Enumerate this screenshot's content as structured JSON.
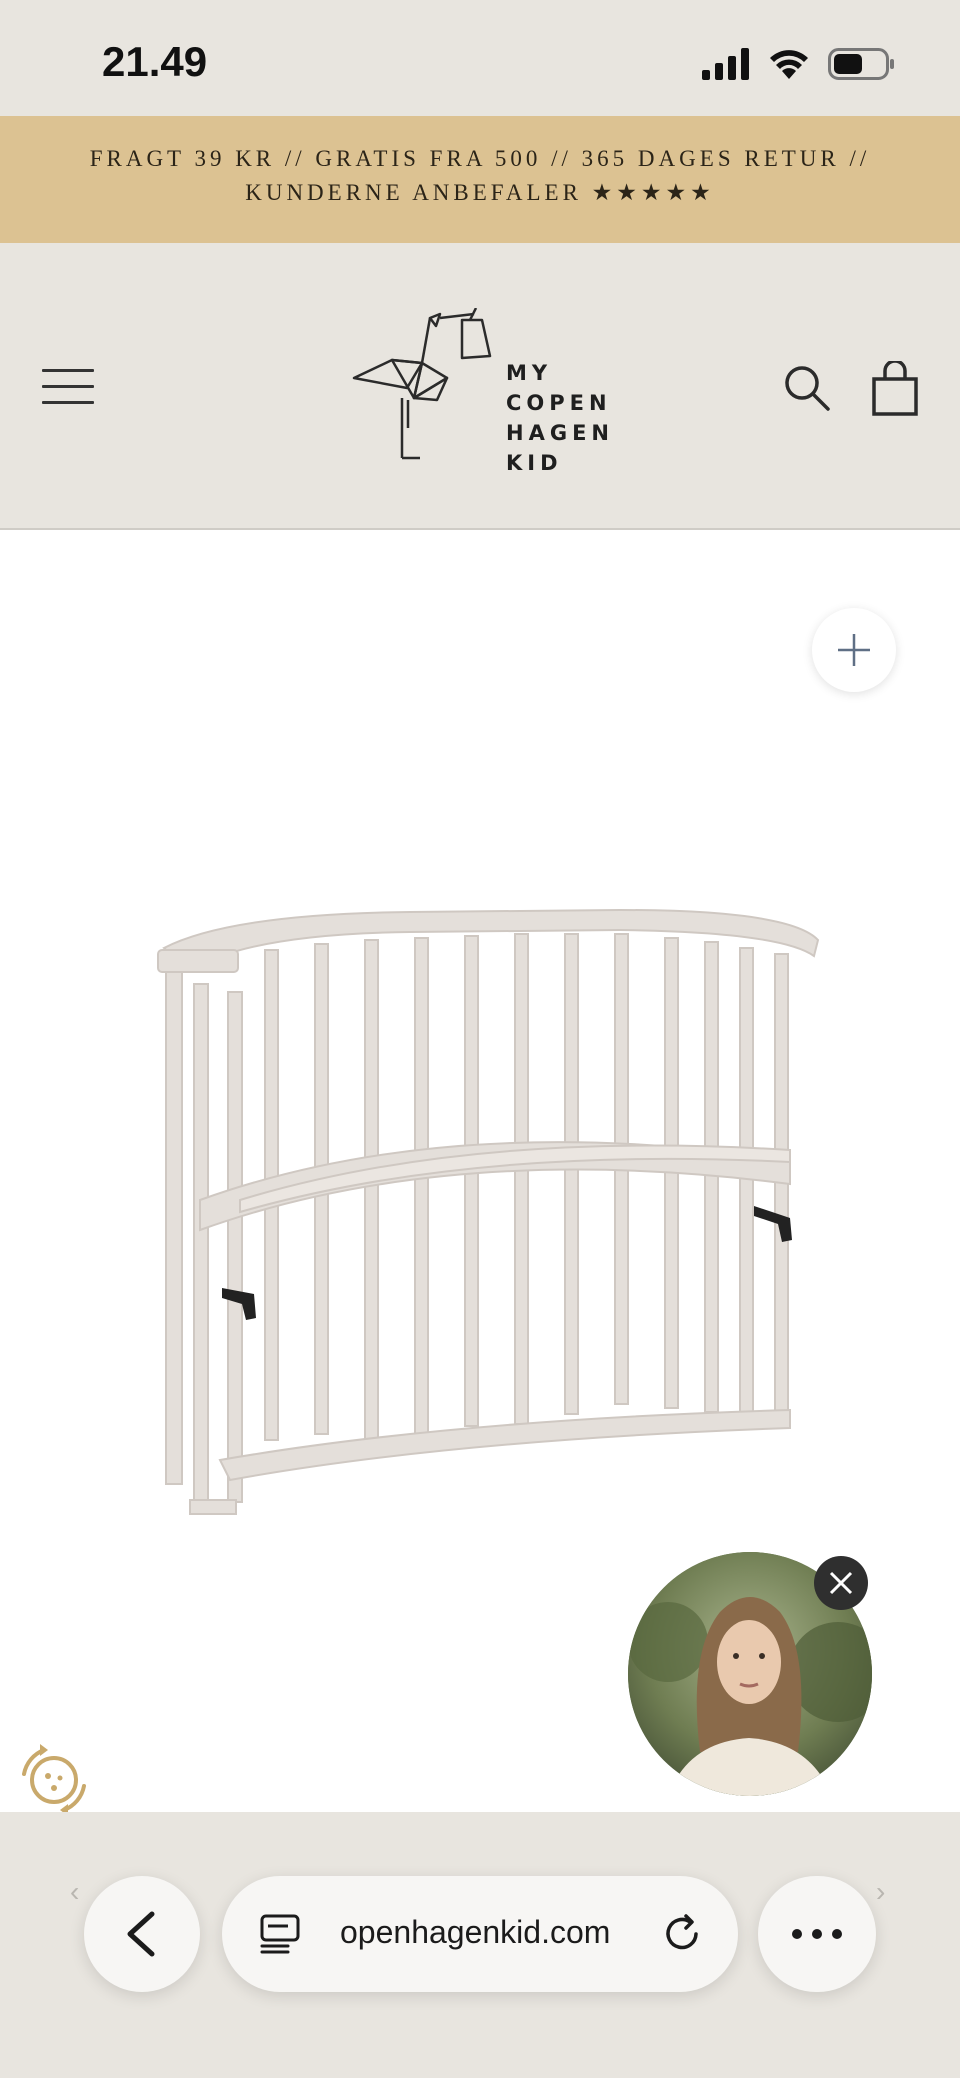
{
  "status_bar": {
    "time": "21.49"
  },
  "promo": {
    "line1": "FRAGT 39 KR // GRATIS FRA 500 // 365 DAGES RETUR //",
    "line2": "KUNDERNE ANBEFALER ★★★★★"
  },
  "header": {
    "logo_lines": [
      "MY",
      "COPEN",
      "HAGEN",
      "KID"
    ]
  },
  "browser": {
    "url": "openhagenkid.com"
  },
  "icons": {
    "menu": "hamburger-icon",
    "search": "search-icon",
    "cart": "shopping-bag-icon",
    "zoom": "plus-icon",
    "close": "close-icon",
    "back": "chevron-left-icon",
    "reader": "reader-icon",
    "reload": "reload-icon",
    "more": "more-icon",
    "cookie": "cookie-icon"
  },
  "colors": {
    "banner": "#dcc292",
    "header_bg": "#e8e5df",
    "crib": "#e4dfda"
  }
}
